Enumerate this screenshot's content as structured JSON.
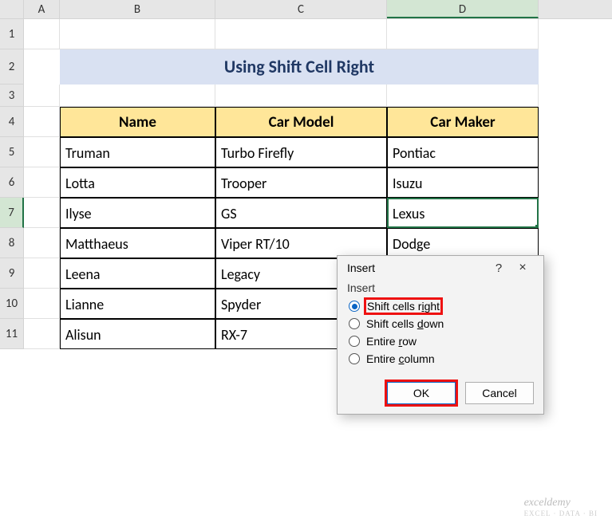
{
  "columns": {
    "A": "A",
    "B": "B",
    "C": "C",
    "D": "D"
  },
  "row_numbers": [
    "1",
    "2",
    "3",
    "4",
    "5",
    "6",
    "7",
    "8",
    "9",
    "10",
    "11"
  ],
  "title": "Using Shift Cell Right",
  "headers": {
    "name": "Name",
    "model": "Car Model",
    "maker": "Car Maker"
  },
  "rows": [
    {
      "name": "Truman",
      "model": "Turbo Firefly",
      "maker": "Pontiac"
    },
    {
      "name": "Lotta",
      "model": "Trooper",
      "maker": "Isuzu"
    },
    {
      "name": "Ilyse",
      "model": "GS",
      "maker": "Lexus"
    },
    {
      "name": "Matthaeus",
      "model": "Viper RT/10",
      "maker": "Dodge"
    },
    {
      "name": "Leena",
      "model": "Legacy",
      "maker": ""
    },
    {
      "name": "Lianne",
      "model": "Spyder",
      "maker": ""
    },
    {
      "name": "Alisun",
      "model": "RX-7",
      "maker": ""
    }
  ],
  "dialog": {
    "title": "Insert",
    "group_label": "Insert",
    "options": {
      "right": {
        "pre": "Shift cells r",
        "u": "i",
        "post": "ght"
      },
      "down": {
        "pre": "Shift cells ",
        "u": "d",
        "post": "own"
      },
      "row": {
        "pre": "Entire ",
        "u": "r",
        "post": "ow"
      },
      "column": {
        "pre": "Entire ",
        "u": "c",
        "post": "olumn"
      }
    },
    "ok": "OK",
    "cancel": "Cancel",
    "help": "?",
    "close": "×"
  },
  "watermark": {
    "main": "exceldemy",
    "sub": "EXCEL · DATA · BI"
  }
}
